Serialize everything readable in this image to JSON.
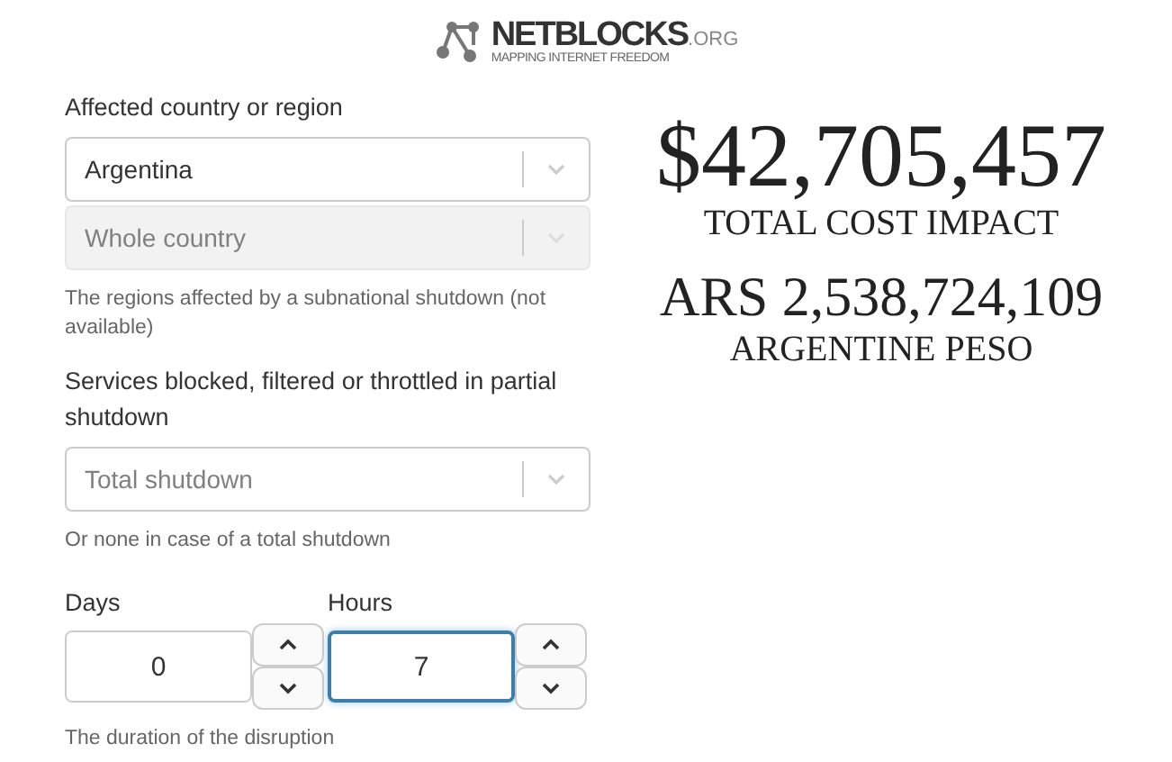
{
  "logo": {
    "name": "NETBLOCKS",
    "suffix": ".ORG",
    "tagline": "MAPPING INTERNET FREEDOM"
  },
  "form": {
    "country": {
      "label": "Affected country or region",
      "selects": [
        {
          "value": "Argentina",
          "disabled": false,
          "kind": "value"
        },
        {
          "value": "Whole country",
          "disabled": true,
          "kind": "value"
        }
      ],
      "help": "The regions affected by a subnational shutdown (not available)"
    },
    "services": {
      "label": "Services blocked, filtered or throttled in partial shutdown",
      "selects": [
        {
          "value": "Total shutdown",
          "disabled": false,
          "kind": "placeholder"
        }
      ],
      "help": "Or none in case of a total shutdown"
    },
    "duration": {
      "fields": [
        {
          "label": "Days",
          "value": "0",
          "focused": false
        },
        {
          "label": "Hours",
          "value": "7",
          "focused": true
        }
      ],
      "help": "The duration of the disruption"
    }
  },
  "results": [
    {
      "amount": "$42,705,457",
      "caption": "TOTAL COST IMPACT",
      "kind": "total"
    },
    {
      "amount": "ARS 2,538,724,109",
      "caption": "ARGENTINE PESO",
      "kind": "local"
    }
  ]
}
